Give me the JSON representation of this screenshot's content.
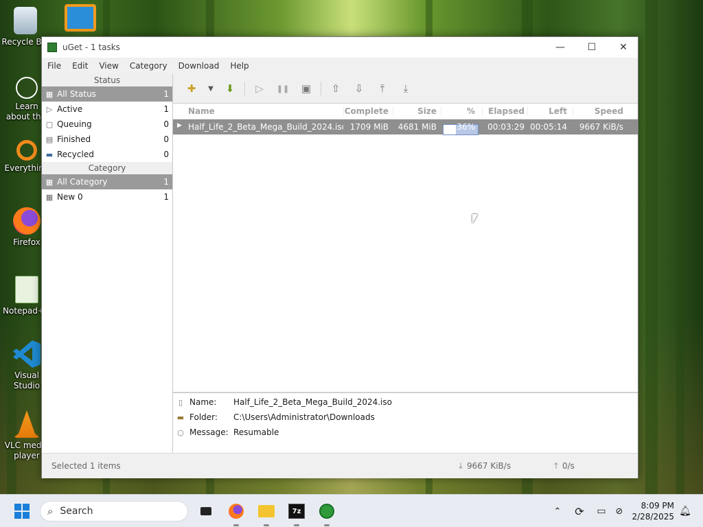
{
  "desktop": {
    "icons": [
      {
        "label": "Recycle Bin",
        "icon": "recycle-bin-icon"
      },
      {
        "label": "Learn about this picture",
        "icon": "learn-picture-icon"
      },
      {
        "label": "Everything",
        "icon": "everything-icon"
      },
      {
        "label": "Firefox",
        "icon": "firefox-icon"
      },
      {
        "label": "Notepad++",
        "icon": "notepadpp-icon"
      },
      {
        "label": "Visual Studio Code",
        "icon": "vscode-icon"
      },
      {
        "label": "VLC media player",
        "icon": "vlc-icon"
      }
    ]
  },
  "window": {
    "title": "uGet - 1 tasks",
    "controls": {
      "minimize": "—",
      "maximize": "☐",
      "close": "✕"
    },
    "menu": [
      "File",
      "Edit",
      "View",
      "Category",
      "Download",
      "Help"
    ]
  },
  "sidebar": {
    "status_header": "Status",
    "status_items": [
      {
        "label": "All Status",
        "count": "1",
        "icon": "all-status-icon",
        "selected": true
      },
      {
        "label": "Active",
        "count": "1",
        "icon": "active-icon"
      },
      {
        "label": "Queuing",
        "count": "0",
        "icon": "queuing-icon"
      },
      {
        "label": "Finished",
        "count": "0",
        "icon": "finished-icon"
      },
      {
        "label": "Recycled",
        "count": "0",
        "icon": "recycled-icon"
      }
    ],
    "category_header": "Category",
    "category_items": [
      {
        "label": "All Category",
        "count": "1",
        "icon": "all-category-icon",
        "selected": true
      },
      {
        "label": "New 0",
        "count": "1",
        "icon": "category-icon"
      }
    ]
  },
  "toolbar": {
    "buttons": [
      "new-download-icon",
      "dropdown-arrow-icon",
      "batch-download-icon",
      "start-icon",
      "pause-icon",
      "properties-icon",
      "move-up-icon",
      "move-down-icon",
      "move-top-icon",
      "move-bottom-icon"
    ]
  },
  "list": {
    "columns": {
      "name": "Name",
      "complete": "Complete",
      "size": "Size",
      "percent": "%",
      "elapsed": "Elapsed",
      "left": "Left",
      "speed": "Speed"
    },
    "rows": [
      {
        "name": "Half_Life_2_Beta_Mega_Build_2024.iso",
        "complete": "1709 MiB",
        "size": "4681 MiB",
        "percent": "36%",
        "progress": 0.365,
        "elapsed": "00:03:29",
        "left": "00:05:14",
        "speed": "9667 KiB/s"
      }
    ]
  },
  "details": {
    "name_label": "Name:",
    "name_value": "Half_Life_2_Beta_Mega_Build_2024.iso",
    "folder_label": "Folder:",
    "folder_value": "C:\\Users\\Administrator\\Downloads",
    "message_label": "Message:",
    "message_value": "Resumable"
  },
  "statusbar": {
    "selected": "Selected 1 items",
    "down_speed": "9667 KiB/s",
    "up_speed": "0/s"
  },
  "taskbar": {
    "search_placeholder": "Search",
    "time": "8:09 PM",
    "date": "2/28/2025"
  },
  "colors": {
    "selection": "#9a9a9a",
    "progress_border": "#6f8fc7",
    "accent_green": "#2e7d32"
  }
}
